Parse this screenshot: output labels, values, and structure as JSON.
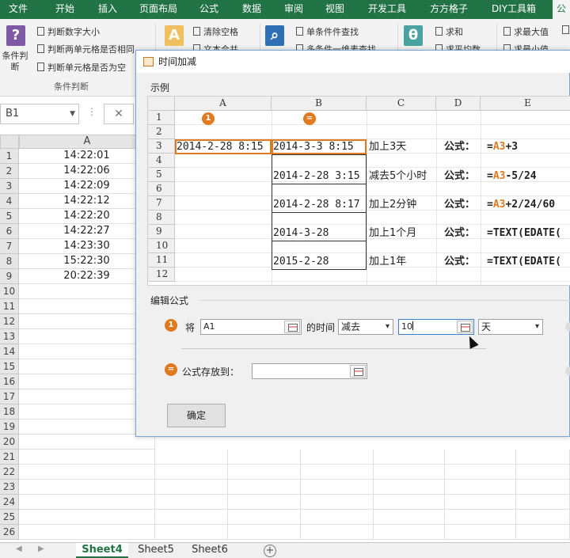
{
  "tabs": [
    "文件",
    "开始",
    "插入",
    "页面布局",
    "公式",
    "数据",
    "审阅",
    "视图",
    "开发工具",
    "方方格子",
    "DIY工具箱",
    "公"
  ],
  "ribbon": {
    "condition_big_label": "条件判断",
    "condition_items": [
      "判断数字大小",
      "判断两单元格是否相同",
      "判断单元格是否为空"
    ],
    "group_label": "条件判断",
    "text_items": [
      "清除空格",
      "文本合并"
    ],
    "lookup_items": [
      "单条件件查找",
      "多条件一维表查找"
    ],
    "math_items": [
      "求和",
      "求平均数"
    ],
    "stat_items": [
      "求最大值",
      "求最小值"
    ]
  },
  "formula_bar": {
    "name_box": "B1",
    "cancel": "✕",
    "dots": "⋮"
  },
  "sheet": {
    "column_a": "A",
    "rows": [
      "1",
      "2",
      "3",
      "4",
      "5",
      "6",
      "7",
      "8",
      "9",
      "10",
      "11",
      "12",
      "13",
      "14",
      "15",
      "16",
      "17",
      "18",
      "19",
      "20",
      "21",
      "22",
      "23",
      "24",
      "25",
      "26"
    ],
    "values": [
      "14:22:01",
      "14:22:06",
      "14:22:09",
      "14:22:12",
      "14:22:20",
      "14:22:27",
      "14:23:30",
      "15:22:30",
      "20:22:39"
    ]
  },
  "sheet_tabs": [
    "Sheet4",
    "Sheet5",
    "Sheet6"
  ],
  "dialog": {
    "title": "时间加减",
    "example_label": "示例",
    "example": {
      "columns": [
        "A",
        "B",
        "C",
        "D",
        "E"
      ],
      "rows": [
        "1",
        "2",
        "3",
        "4",
        "5",
        "6",
        "7",
        "8",
        "9",
        "10",
        "11",
        "12"
      ],
      "marker1": "1",
      "marker2": "=",
      "a3": "2014-2-28 8:15",
      "b3": "2014-3-3 8:15",
      "b5": "2014-2-28 3:15",
      "b7": "2014-2-28 8:17",
      "b9": "2014-3-28",
      "b11": "2015-2-28",
      "c3": "加上3天",
      "c5": "减去5个小时",
      "c7": "加上2分钟",
      "c9": "加上1个月",
      "c11": "加上1年",
      "formula_label": "公式：",
      "e3_eq": "=",
      "e3_ref": "A3",
      "e3_rest": "+3",
      "e5_eq": "=",
      "e5_ref": "A3",
      "e5_rest": "-5/24",
      "e7_eq": "=",
      "e7_ref": "A3",
      "e7_rest": "+2/24/60",
      "e9": "=TEXT(EDATE(",
      "e11": "=TEXT(EDATE("
    },
    "edit_label": "编辑公式",
    "step1_marker": "1",
    "step1_jiang": "将",
    "cell_ref": "A1",
    "time_of": "的时间",
    "operation": "减去",
    "amount": "10",
    "unit": "天",
    "step2_marker": "=",
    "store_label": "公式存放到：",
    "store_value": "",
    "ok_label": "确定"
  },
  "colors": {
    "excel_green": "#217346",
    "accent_orange": "#e07a1f"
  }
}
